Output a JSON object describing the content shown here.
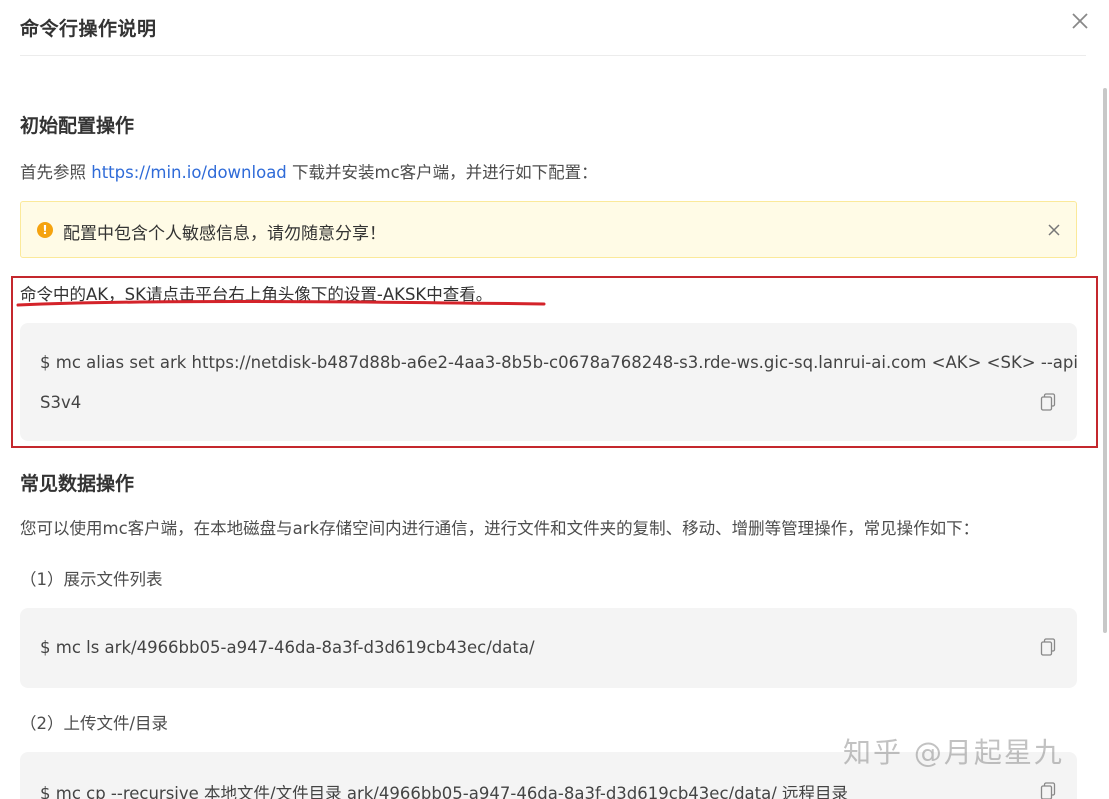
{
  "modal": {
    "title": "命令行操作说明"
  },
  "initial_config": {
    "heading": "初始配置操作",
    "intro_before_link": "首先参照 ",
    "link_text": "https://min.io/download",
    "intro_after_link": " 下载并安装mc客户端，并进行如下配置："
  },
  "alert": {
    "text": "配置中包含个人敏感信息，请勿随意分享！"
  },
  "ak_sk_note": "命令中的AK，SK请点击平台右上角头像下的设置-AKSK中查看。",
  "config_command": {
    "line1": "$ mc alias set ark https://netdisk-b487d88b-a6e2-4aa3-8b5b-c0678a768248-s3.rde-ws.gic-sq.lanrui-ai.com <AK> <SK> --api",
    "line2": "S3v4"
  },
  "common_ops": {
    "heading": "常见数据操作",
    "intro": "您可以使用mc客户端，在本地磁盘与ark存储空间内进行通信，进行文件和文件夹的复制、移动、增删等管理操作，常见操作如下：",
    "steps": [
      {
        "label": "（1）展示文件列表",
        "command": "$ mc ls ark/4966bb05-a947-46da-8a3f-d3d619cb43ec/data/"
      },
      {
        "label": "（2）上传文件/目录",
        "command": "$ mc cp --recursive 本地文件/文件目录 ark/4966bb05-a947-46da-8a3f-d3d619cb43ec/data/ 远程目录"
      }
    ]
  },
  "watermark": "知乎 @月起星九",
  "colors": {
    "link": "#2f6bd8",
    "alert_bg": "#fffbe6",
    "alert_icon": "#f5a30f",
    "highlight_border": "#c4272d",
    "code_bg": "#f4f4f4"
  }
}
